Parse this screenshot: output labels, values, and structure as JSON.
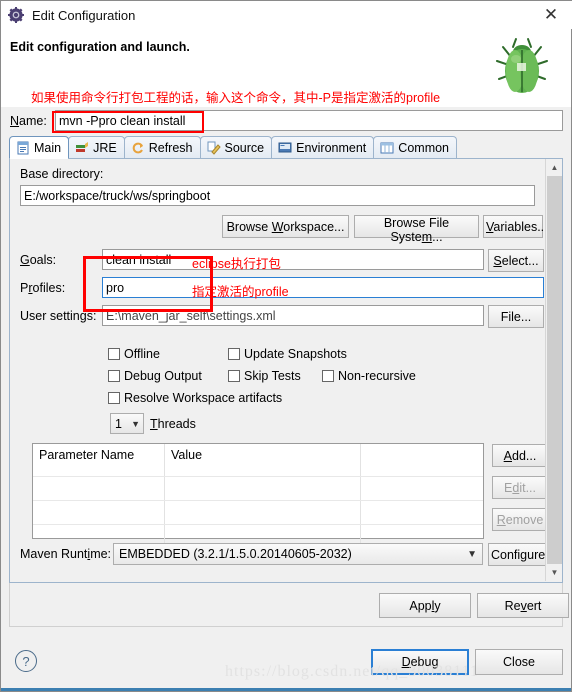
{
  "window": {
    "title": "Edit Configuration",
    "icon": "config-gear-icon",
    "close_label": "✕"
  },
  "header": {
    "title": "Edit configuration and launch.",
    "annotation": "如果使用命令行打包工程的话，输入这个命令，其中-P是指定激活的profile",
    "icon": "green-bug-icon"
  },
  "name_field": {
    "label": "Name:",
    "value": "mvn -Ppro clean install",
    "placeholder": ""
  },
  "tabs": [
    {
      "label": "Main",
      "icon": "main-tab-icon",
      "active": true
    },
    {
      "label": "JRE",
      "icon": "jre-tab-icon",
      "active": false
    },
    {
      "label": "Refresh",
      "icon": "refresh-tab-icon",
      "active": false
    },
    {
      "label": "Source",
      "icon": "source-tab-icon",
      "active": false
    },
    {
      "label": "Environment",
      "icon": "environment-tab-icon",
      "active": false
    },
    {
      "label": "Common",
      "icon": "common-tab-icon",
      "active": false
    }
  ],
  "main": {
    "base_directory": {
      "label": "Base directory:",
      "value": "E:/workspace/truck/ws/springboot",
      "browse_workspace": "Browse Workspace...",
      "browse_file_system": "Browse File System...",
      "variables": "Variables..."
    },
    "goals": {
      "label": "Goals:",
      "value": "clean install",
      "select_button": "Select...",
      "annotation": "eclipse执行打包"
    },
    "profiles": {
      "label": "Profiles:",
      "value": "pro",
      "annotation": "指定激活的profile",
      "focused": true
    },
    "user_settings": {
      "label": "User settings:",
      "value": "E:\\maven_jar_self\\settings.xml",
      "file_button": "File..."
    },
    "checkboxes": [
      {
        "label": "Offline",
        "checked": false
      },
      {
        "label": "Update Snapshots",
        "checked": false
      },
      {
        "label": "Debug Output",
        "checked": false
      },
      {
        "label": "Skip Tests",
        "checked": false
      },
      {
        "label": "Non-recursive",
        "checked": false
      },
      {
        "label": "Resolve Workspace artifacts",
        "checked": false
      }
    ],
    "threads": {
      "label": "Threads",
      "value": "1"
    },
    "parameters": {
      "columns": [
        "Parameter Name",
        "Value",
        ""
      ],
      "rows": [],
      "add_button": "Add...",
      "edit_button": "Edit...",
      "remove_button": "Remove"
    },
    "maven_runtime": {
      "label": "Maven Runtime:",
      "value": "EMBEDDED (3.2.1/1.5.0.20140605-2032)",
      "configure_button": "Configure..."
    }
  },
  "actions": {
    "apply": "Apply",
    "revert": "Revert",
    "debug": "Debug",
    "close": "Close",
    "help": "?"
  },
  "watermark": "https://blog.csdn.net/qq_30038111",
  "colors": {
    "annotation_red": "#ff0000",
    "focus_blue": "#2a7fd4",
    "tab_border": "#9db4cc",
    "dialog_bg": "#f0f0f0"
  }
}
